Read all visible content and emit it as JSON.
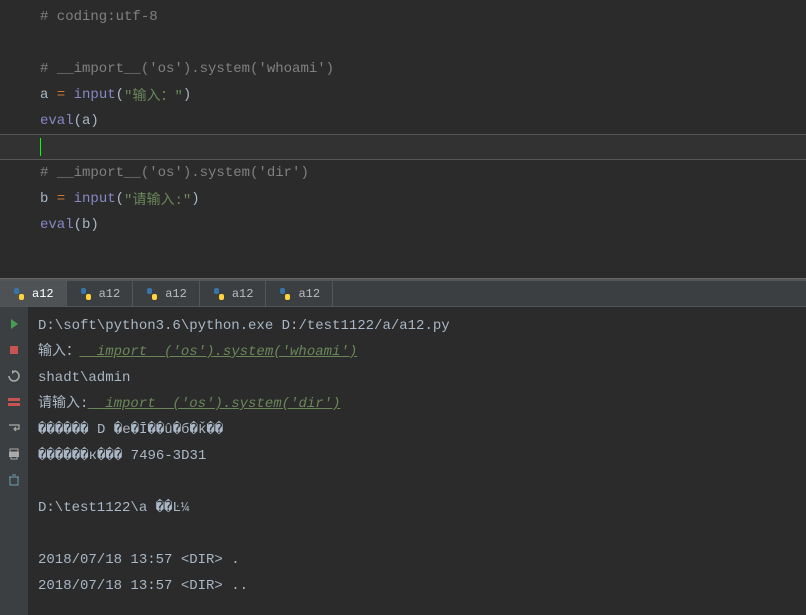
{
  "code": {
    "line1": "# coding:utf-8",
    "line3": "# __import__('os').system('whoami')",
    "line4_a": "a",
    "line4_eq": " = ",
    "line4_input": "input",
    "line4_lp": "(",
    "line4_str": "\"输入：\"",
    "line4_rp": ")",
    "line5_eval": "eval",
    "line5_lp": "(",
    "line5_a": "a",
    "line5_rp": ")",
    "line7": "# __import__('os').system('dir')",
    "line8_b": "b",
    "line8_eq": " = ",
    "line8_input": "input",
    "line8_lp": "(",
    "line8_str": "\"请输入:\"",
    "line8_rp": ")",
    "line9_eval": "eval",
    "line9_lp": "(",
    "line9_b": "b",
    "line9_rp": ")"
  },
  "tabs": [
    "a12",
    "a12",
    "a12",
    "a12",
    "a12"
  ],
  "console": {
    "line1": "D:\\soft\\python3.6\\python.exe D:/test1122/a/a12.py",
    "line2_label": "输入：",
    "line2_value": "__import__('os').system('whoami')",
    "line3": "shadt\\admin",
    "line4_label": "请输入:",
    "line4_value": "__import__('os').system('dir')",
    "line5": " ������ D �е�Ī��û�б�ǩ��",
    "line6": " ������к��� 7496-3D31",
    "line8": " D:\\test1122\\a ��Ŀ¼",
    "line10": "2018/07/18  13:57    <DIR>          .",
    "line11": "2018/07/18  13:57    <DIR>          .."
  }
}
